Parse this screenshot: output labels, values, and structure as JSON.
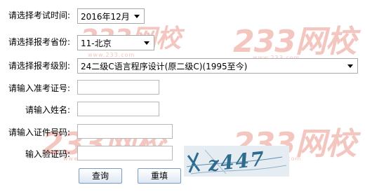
{
  "form": {
    "exam_time": {
      "label": "请选择考试时间:",
      "value": "2016年12月"
    },
    "province": {
      "label": "请选择报考省份:",
      "value": "11-北京"
    },
    "level": {
      "label": "请选择报考级别:",
      "value": "24二级C语言程序设计(原二级C)(1995至今)"
    },
    "ticket_no": {
      "label": "请输入准考证号:",
      "value": ""
    },
    "name": {
      "label": "请输入姓名:",
      "value": ""
    },
    "id_no": {
      "label": "请输入证件号码:",
      "value": ""
    },
    "captcha": {
      "label": "输入验证码:",
      "value": "",
      "image_text": "z447"
    }
  },
  "buttons": {
    "query": "查询",
    "reset": "重填"
  },
  "watermark": {
    "text": "233网校",
    "sub": "www.233.com"
  },
  "colors": {
    "watermark": "#f3c6c0",
    "button_border": "#7d9ac0",
    "captcha_text": "#2d6b8f"
  }
}
